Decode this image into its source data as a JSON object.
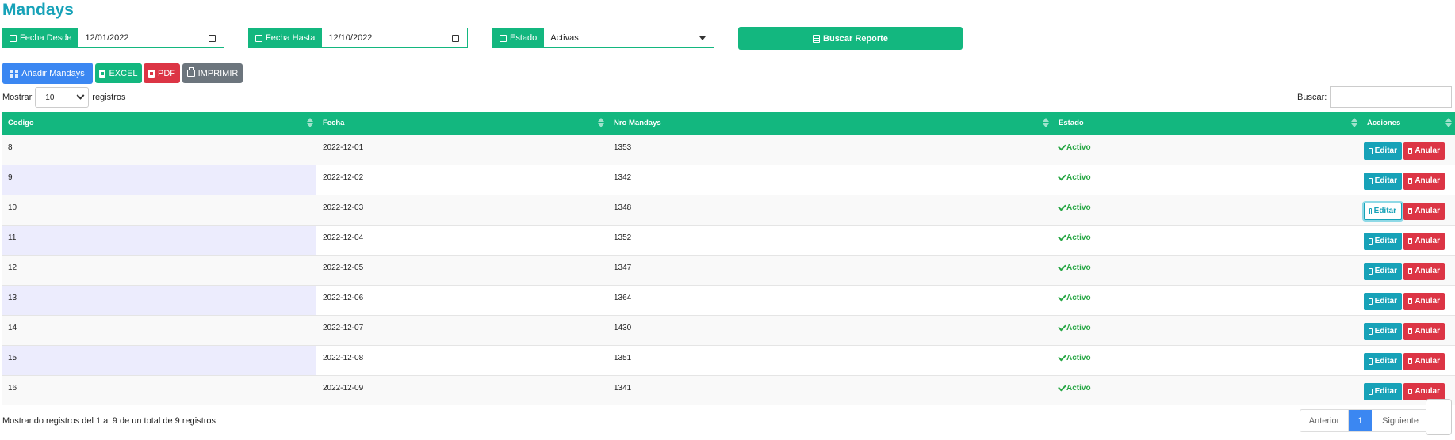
{
  "page": {
    "title": "Mandays"
  },
  "filters": {
    "desde": {
      "label": "Fecha Desde",
      "value": "12/01/2022"
    },
    "hasta": {
      "label": "Fecha Hasta",
      "value": "12/10/2022"
    },
    "estado": {
      "label": "Estado",
      "value": "Activas"
    },
    "buscar_reporte": "Buscar Reporte"
  },
  "toolbar": {
    "add": "Añadir Mandays",
    "excel": "EXCEL",
    "pdf": "PDF",
    "print": "IMPRIMIR"
  },
  "length": {
    "prefix": "Mostrar",
    "value": "10",
    "suffix": "registros"
  },
  "search": {
    "label": "Buscar:",
    "value": ""
  },
  "table": {
    "headers": [
      "Codigo",
      "Fecha",
      "Nro Mandays",
      "Estado",
      "Acciones"
    ],
    "rows": [
      {
        "codigo": "8",
        "fecha": "2022-12-01",
        "nro": "1353",
        "estado": "Activo"
      },
      {
        "codigo": "9",
        "fecha": "2022-12-02",
        "nro": "1342",
        "estado": "Activo"
      },
      {
        "codigo": "10",
        "fecha": "2022-12-03",
        "nro": "1348",
        "estado": "Activo"
      },
      {
        "codigo": "11",
        "fecha": "2022-12-04",
        "nro": "1352",
        "estado": "Activo"
      },
      {
        "codigo": "12",
        "fecha": "2022-12-05",
        "nro": "1347",
        "estado": "Activo"
      },
      {
        "codigo": "13",
        "fecha": "2022-12-06",
        "nro": "1364",
        "estado": "Activo"
      },
      {
        "codigo": "14",
        "fecha": "2022-12-07",
        "nro": "1430",
        "estado": "Activo"
      },
      {
        "codigo": "15",
        "fecha": "2022-12-08",
        "nro": "1351",
        "estado": "Activo"
      },
      {
        "codigo": "16",
        "fecha": "2022-12-09",
        "nro": "1341",
        "estado": "Activo"
      }
    ],
    "actions": {
      "edit": "Editar",
      "cancel": "Anular"
    }
  },
  "footer": {
    "info": "Mostrando registros del 1 al 9 de un total de 9 registros",
    "prev": "Anterior",
    "page": "1",
    "next": "Siguiente"
  },
  "colors": {
    "accent": "#13b77f",
    "primary": "#3b87f2",
    "danger": "#dc3545",
    "info": "#17a2b8"
  }
}
